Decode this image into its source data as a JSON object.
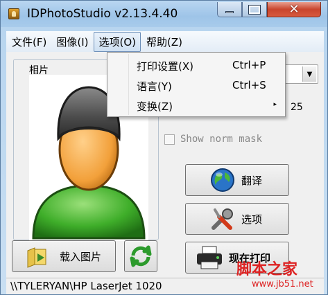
{
  "window": {
    "title": "IDPhotoStudio v2.13.4.40"
  },
  "menubar": {
    "items": [
      {
        "label": "文件(F)"
      },
      {
        "label": "图像(I)"
      },
      {
        "label": "选项(O)"
      },
      {
        "label": "帮助(Z)"
      }
    ]
  },
  "options_menu": {
    "items": [
      {
        "label": "打印设置(X)",
        "accelerator": "Ctrl+P"
      },
      {
        "label": "语言(Y)",
        "accelerator": "Ctrl+S"
      },
      {
        "label": "变换(Z)",
        "accelerator": "",
        "submenu_arrow": "▸"
      }
    ]
  },
  "photo": {
    "legend": "相片"
  },
  "buttons": {
    "load": "载入图片",
    "translate": "翻译",
    "options": "选项",
    "print": "现在打印"
  },
  "settings": {
    "side_value": "25",
    "norm_mask_label": "Show norm mask"
  },
  "statusbar": {
    "printer": "\\\\TYLERYAN\\HP LaserJet 1020"
  },
  "watermark": {
    "text": "脚本之家",
    "url": "www.jb51.net"
  }
}
